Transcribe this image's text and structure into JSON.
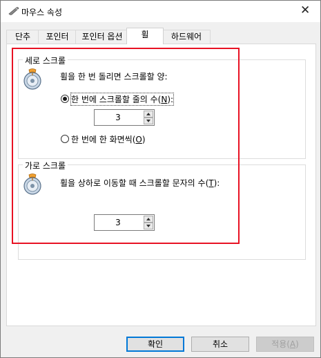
{
  "window": {
    "title": "마우스 속성",
    "close_glyph": "✕"
  },
  "tabs": [
    {
      "label": "단추"
    },
    {
      "label": "포인터"
    },
    {
      "label": "포인터 옵션"
    },
    {
      "label": "휠",
      "active": true
    },
    {
      "label": "하드웨어"
    }
  ],
  "vertical": {
    "group_title": "세로 스크롤",
    "prompt": "휠을 한 번 돌리면 스크롤할 양:",
    "option_lines_label": "한 번에 스크롤할 줄의 수(",
    "option_lines_key": "N",
    "option_lines_end": "):",
    "lines_value": "3",
    "option_screen_label": "한 번에 한 화면씩(",
    "option_screen_key": "O",
    "option_screen_end": ")",
    "selected": "lines"
  },
  "horizontal": {
    "group_title": "가로 스크롤",
    "prompt_start": "휠을 상하로 이동할 때 스크롤할 문자의 수(",
    "prompt_key": "T",
    "prompt_end": "):",
    "chars_value": "3"
  },
  "buttons": {
    "ok": "확인",
    "cancel": "취소",
    "apply_start": "적용(",
    "apply_key": "A",
    "apply_end": ")"
  },
  "colors": {
    "highlight_box": "#e81123",
    "default_button_border": "#0078d7"
  },
  "icons": {
    "window": "mouse-icon",
    "wheel": "mouse-wheel-icon"
  }
}
